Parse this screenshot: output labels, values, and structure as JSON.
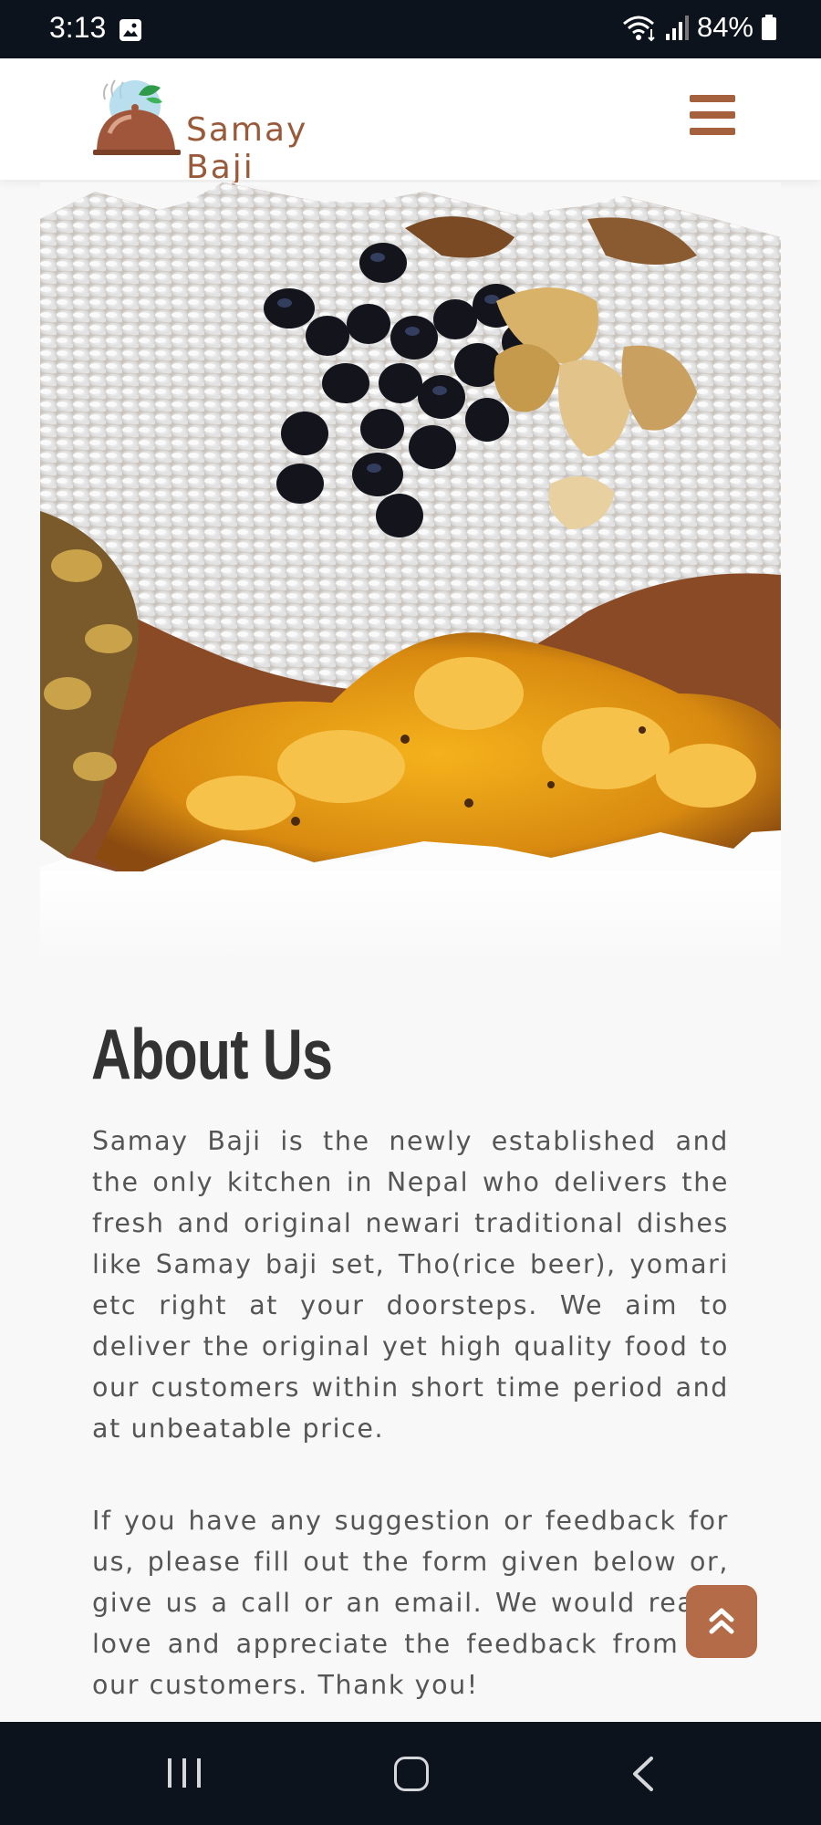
{
  "status_bar": {
    "time": "3:13",
    "battery": "84%",
    "icons": [
      "gallery-icon",
      "wifi-icon",
      "signal-icon",
      "battery-icon"
    ]
  },
  "header": {
    "logo_text": "Samay Baji",
    "menu_icon": "hamburger-menu-icon"
  },
  "about": {
    "title": "About Us",
    "paragraph_1": "Samay Baji is the newly established and the only kitchen in Nepal who delivers the fresh and original newari traditional dishes like Samay baji set, Tho(rice beer), yomari etc right at your doorsteps. We aim to deliver the original yet high quality food to our customers within short time period and at unbeatable price.",
    "paragraph_2": "If you have any suggestion or feedback for us, please fill out the form given below or, give us a call or an email. We would really love and appreciate the feedback from all our customers. Thank you!"
  },
  "scroll_top_icon": "double-chevron-up-icon",
  "nav_bar": {
    "icons": [
      "recent-apps-icon",
      "home-icon",
      "back-icon"
    ]
  },
  "colors": {
    "brand": "#a5603e",
    "button": "#b46b47",
    "system_bar": "#0d131c"
  }
}
